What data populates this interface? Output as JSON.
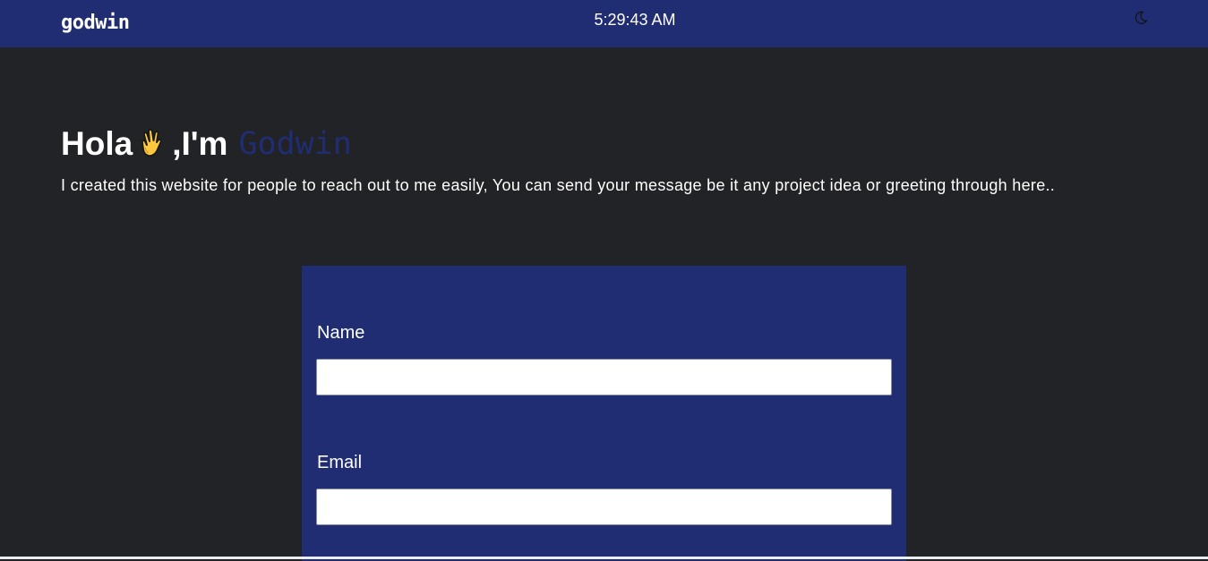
{
  "header": {
    "brand": "godwin",
    "clock": "5:29:43 AM",
    "theme_icon": "moon-icon"
  },
  "hero": {
    "greeting": "Hola",
    "greeting_icon": "waving-hand-icon",
    "im": ",I'm",
    "name": "Godwin",
    "subtitle": "I created this website for people to reach out to me easily, You can send your message be it any project idea or greeting through here.."
  },
  "form": {
    "fields": [
      {
        "label": "Name",
        "value": "",
        "placeholder": ""
      },
      {
        "label": "Email",
        "value": "",
        "placeholder": ""
      }
    ]
  },
  "colors": {
    "header_bg": "#202d72",
    "page_bg": "#222326",
    "card_bg": "#202d72",
    "accent_name": "#202d72"
  }
}
